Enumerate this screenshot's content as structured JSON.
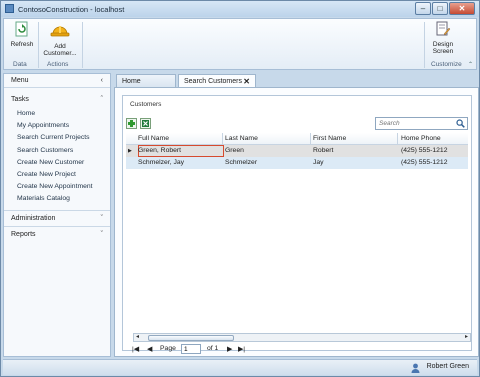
{
  "window": {
    "title": "ContosoConstruction - localhost",
    "controls": {
      "minimize": "–",
      "maximize": "□",
      "close": "✕"
    }
  },
  "ribbon": {
    "refresh_label": "Refresh",
    "add_customer_label_line1": "Add",
    "add_customer_label_line2": "Customer...",
    "group_data": "Data",
    "group_actions": "Actions",
    "design_label_line1": "Design",
    "design_label_line2": "Screen",
    "group_customize": "Customize"
  },
  "nav": {
    "menu_label": "Menu",
    "tasks_label": "Tasks",
    "tasks": [
      "Home",
      "My Appointments",
      "Search Current Projects",
      "Search Customers",
      "Create New Customer",
      "Create New Project",
      "Create New Appointment",
      "Materials Catalog"
    ],
    "administration_label": "Administration",
    "reports_label": "Reports"
  },
  "tabs": {
    "home": "Home",
    "search_customers": "Search Customers",
    "close_glyph": "✕"
  },
  "customers_panel": {
    "caption": "Customers",
    "search_placeholder": "Search",
    "columns": [
      "Full Name",
      "Last Name",
      "First Name",
      "Home Phone"
    ],
    "rows": [
      {
        "full_name": "Green, Robert",
        "last_name": "Green",
        "first_name": "Robert",
        "phone": "(425) 555-1212"
      },
      {
        "full_name": "Schmelzer, Jay",
        "last_name": "Schmelzer",
        "first_name": "Jay",
        "phone": "(425) 555-1212"
      }
    ],
    "row_indicator": "▶"
  },
  "pager": {
    "first": "|◀",
    "prev": "◀",
    "page_label": "Page",
    "page_value": "1",
    "of_label": "of 1",
    "next": "▶",
    "last": "▶|"
  },
  "status": {
    "user_name": "Robert Green"
  },
  "colors": {
    "accent": "#2e5e92",
    "selected_row": "#e1e1e1",
    "alt_row": "#dceaf6",
    "selection_border": "#d64a2e"
  }
}
